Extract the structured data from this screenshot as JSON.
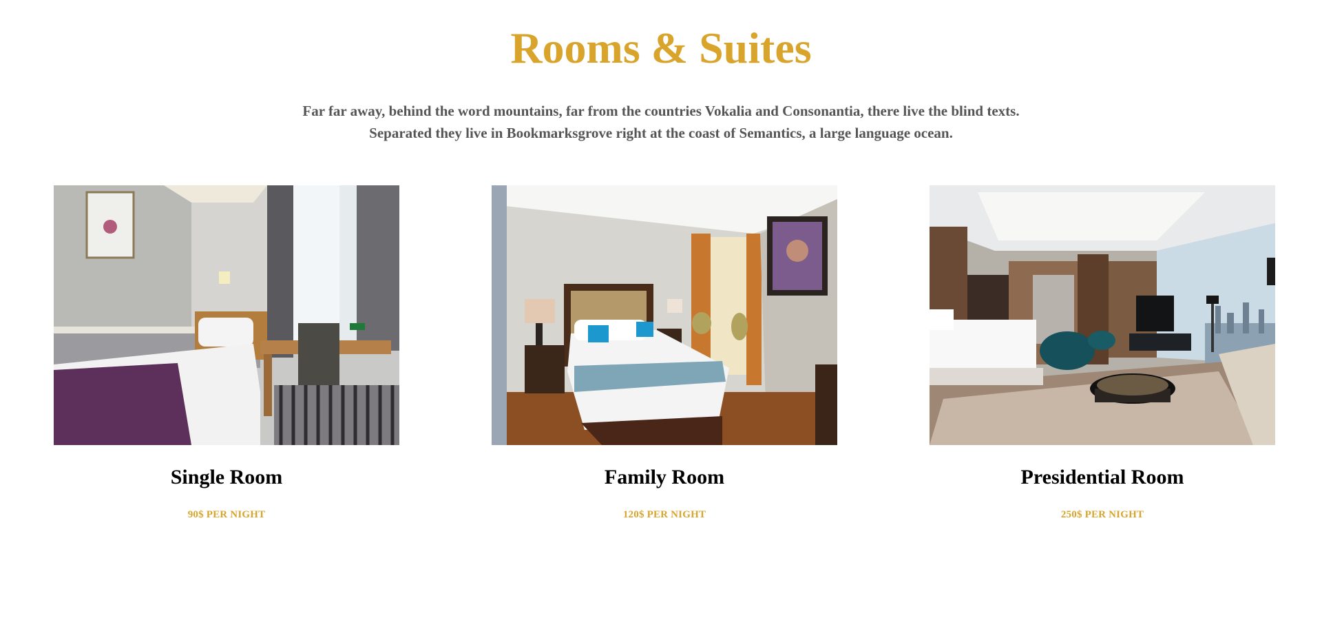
{
  "header": {
    "title": "Rooms & Suites",
    "subtitle_line1": "Far far away, behind the word mountains, far from the countries Vokalia and Consonantia, there live the blind texts.",
    "subtitle_line2": "Separated they live in Bookmarksgrove right at the coast of Semantics, a large language ocean."
  },
  "rooms": [
    {
      "name": "Single Room",
      "price": "90$ PER NIGHT",
      "image_icon": "single-room-photo"
    },
    {
      "name": "Family Room",
      "price": "120$ PER NIGHT",
      "image_icon": "family-room-photo"
    },
    {
      "name": "Presidential Room",
      "price": "250$ PER NIGHT",
      "image_icon": "presidential-room-photo"
    }
  ],
  "colors": {
    "accent": "#d9a42b",
    "text_muted": "#555555",
    "text_dark": "#000000"
  }
}
